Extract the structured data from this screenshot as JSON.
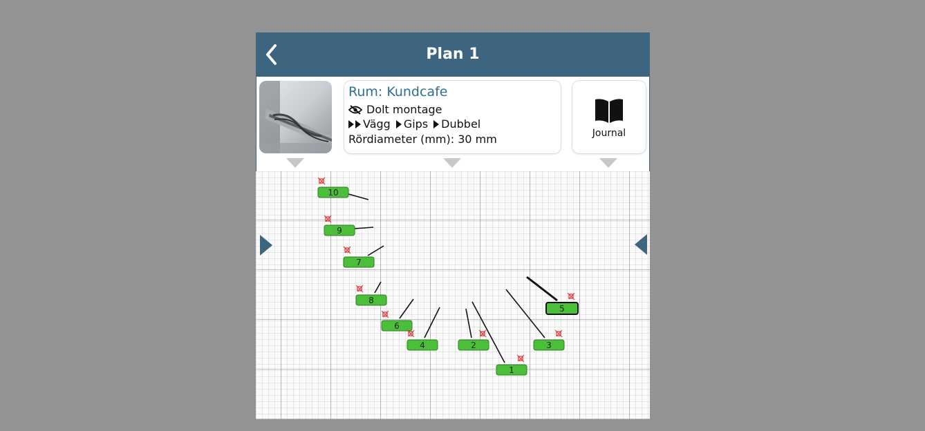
{
  "header": {
    "title": "Plan 1",
    "back_icon": "chevron-left-icon"
  },
  "info": {
    "room": "Rum: Kundcafe",
    "mount": "Dolt montage",
    "mount_icon": "eye-slash-icon",
    "path": [
      "Vägg",
      "Gips",
      "Dubbel"
    ],
    "diameter": "Rördiameter (mm): 30 mm"
  },
  "journal": {
    "label": "Journal",
    "icon": "book-open-icon"
  },
  "colors": {
    "header_bg": "#3d6580",
    "room_text": "#2f6f95",
    "marker_fill": "#4cbf3a",
    "marker_target": "#e03030",
    "nav_arrow": "#3d6580"
  },
  "markers": [
    {
      "label": "10",
      "selected": false
    },
    {
      "label": "9",
      "selected": false
    },
    {
      "label": "7",
      "selected": false
    },
    {
      "label": "8",
      "selected": false
    },
    {
      "label": "6",
      "selected": false
    },
    {
      "label": "4",
      "selected": false
    },
    {
      "label": "2",
      "selected": false
    },
    {
      "label": "1",
      "selected": false
    },
    {
      "label": "3",
      "selected": false
    },
    {
      "label": "5",
      "selected": true
    }
  ]
}
